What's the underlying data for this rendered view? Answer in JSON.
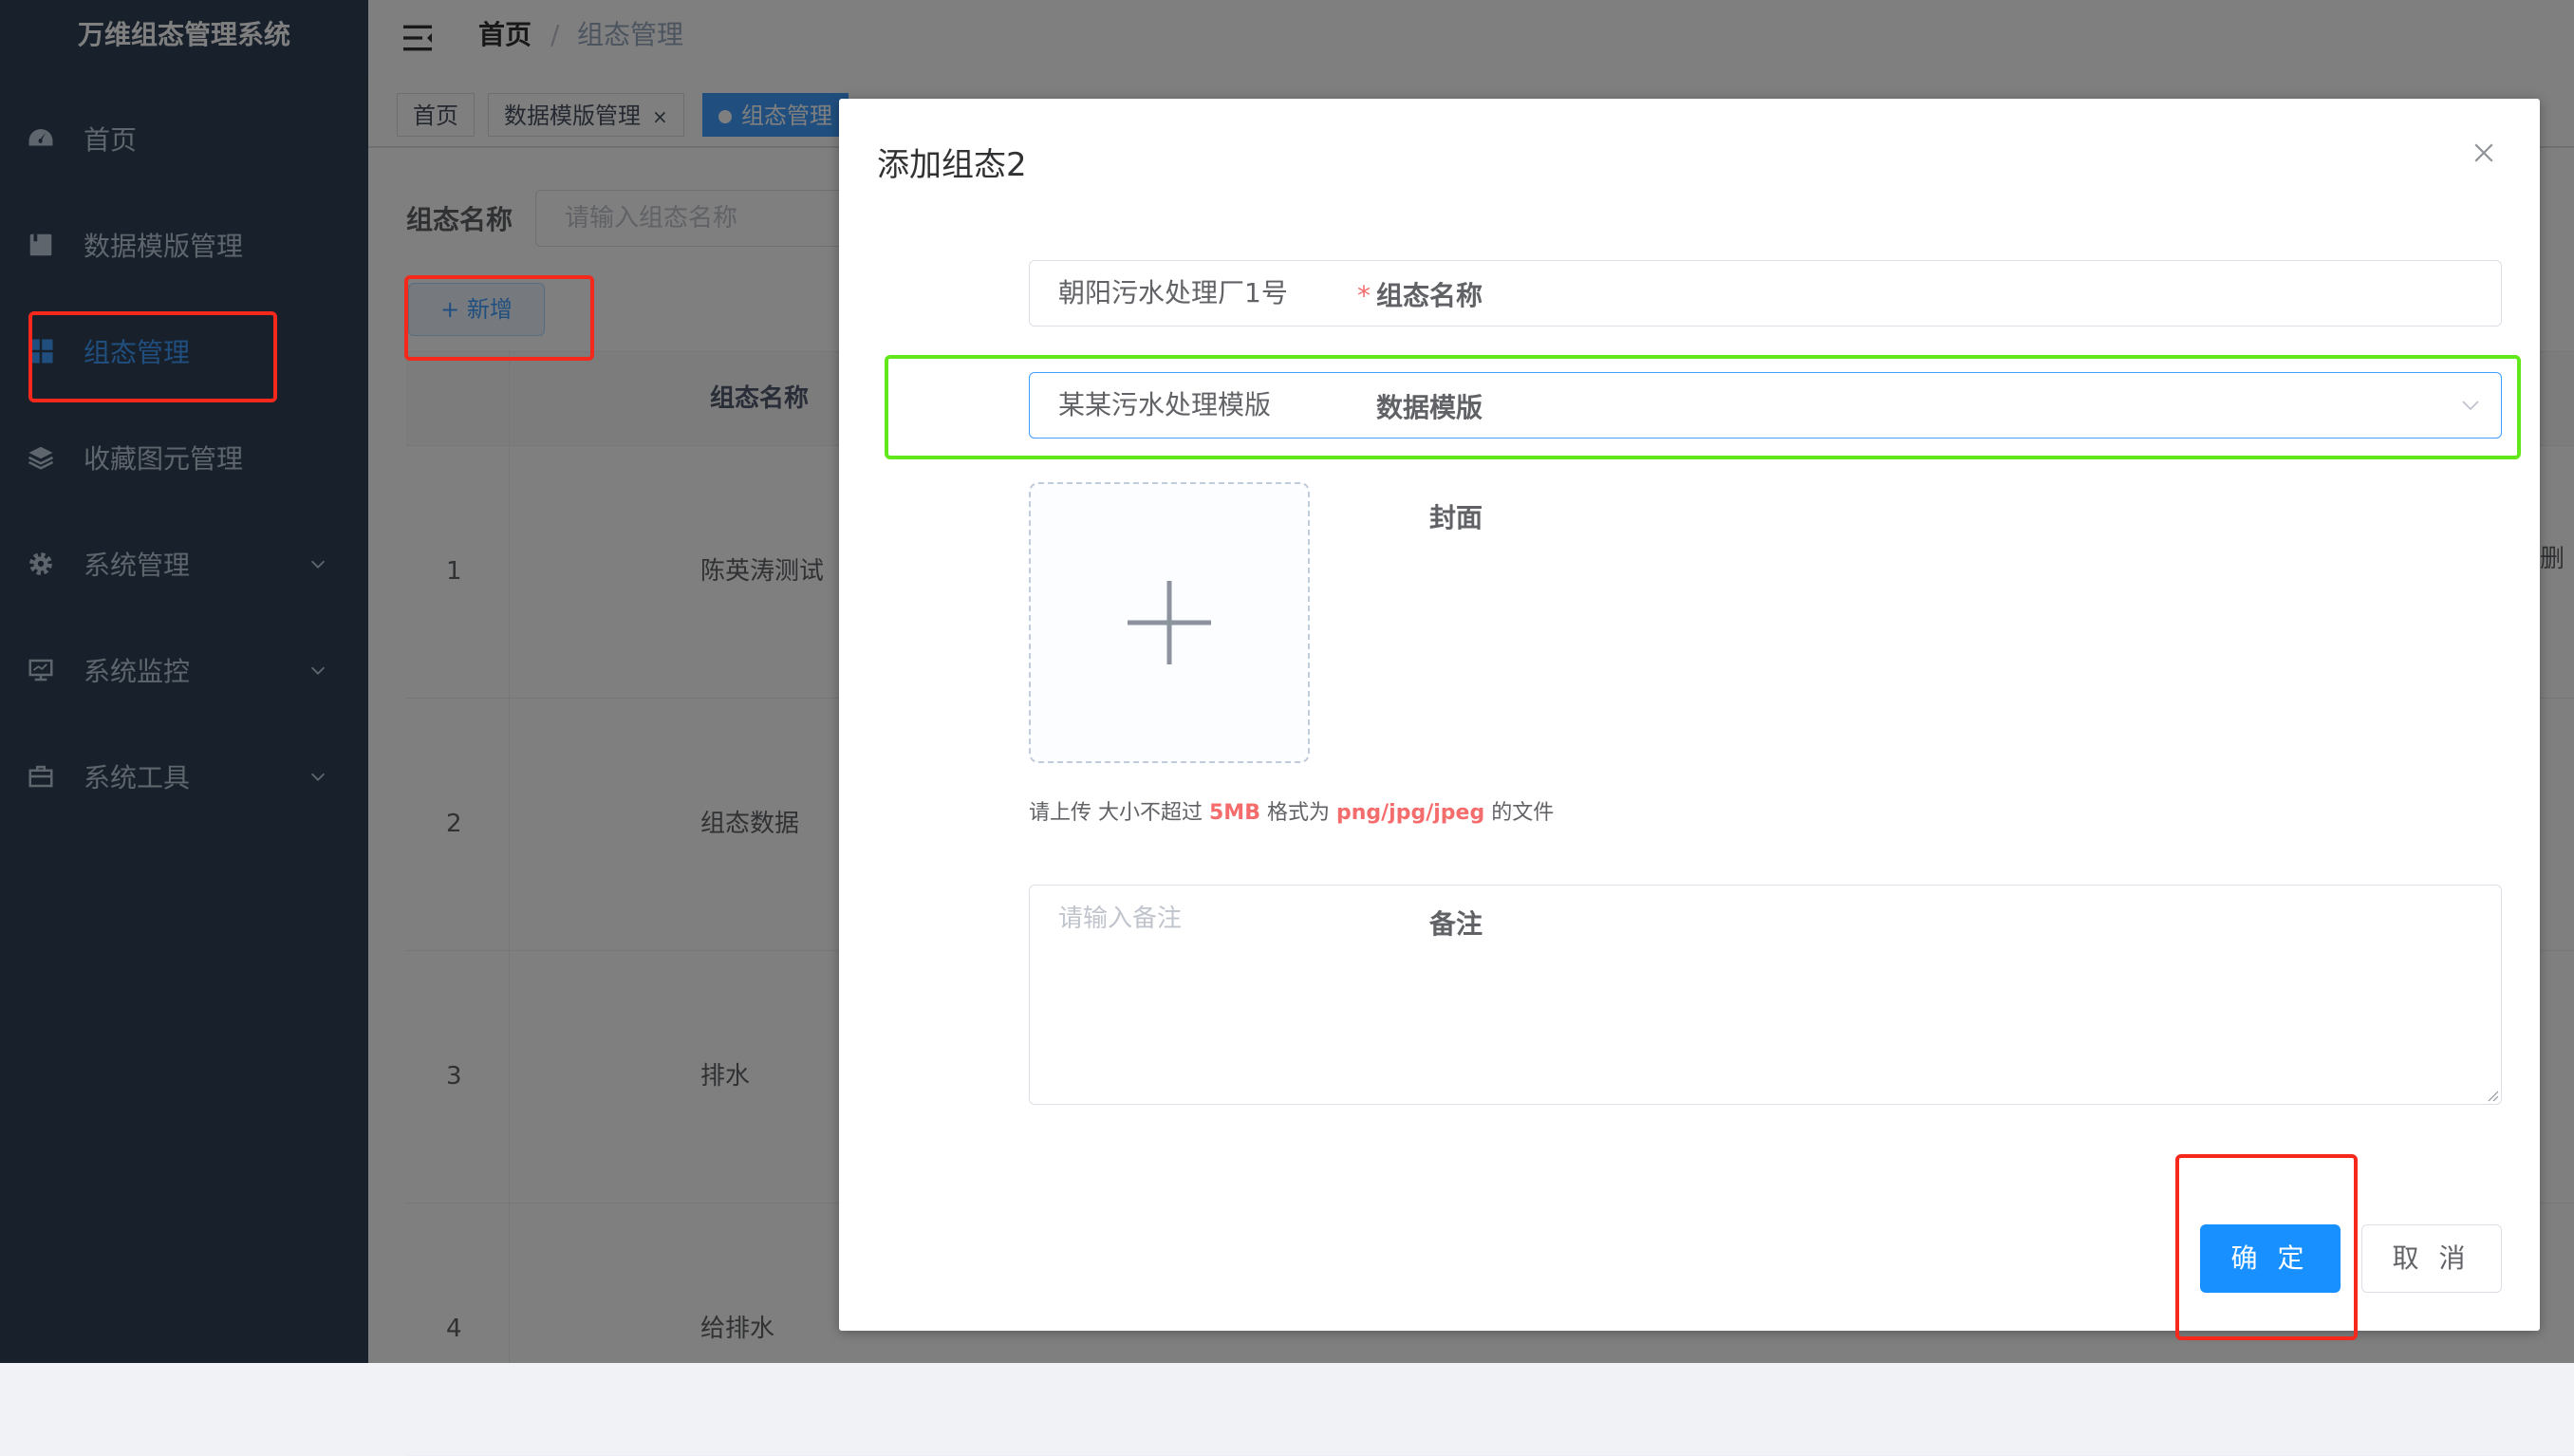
{
  "app": {
    "title": "万维组态管理系统"
  },
  "sidebar": {
    "items": [
      {
        "label": "首页",
        "icon": "dashboard-icon"
      },
      {
        "label": "数据模版管理",
        "icon": "document-icon"
      },
      {
        "label": "组态管理",
        "icon": "grid-icon",
        "active": true
      },
      {
        "label": "收藏图元管理",
        "icon": "layers-icon"
      },
      {
        "label": "系统管理",
        "icon": "gear-icon",
        "expandable": true
      },
      {
        "label": "系统监控",
        "icon": "monitor-icon",
        "expandable": true
      },
      {
        "label": "系统工具",
        "icon": "toolbox-icon",
        "expandable": true
      }
    ]
  },
  "breadcrumb": {
    "home": "首页",
    "separator": "/",
    "current": "组态管理"
  },
  "tags": [
    {
      "label": "首页"
    },
    {
      "label": "数据模版管理",
      "closable": true,
      "close": "×"
    },
    {
      "label": "组态管理",
      "active": true
    }
  ],
  "query": {
    "label": "组态名称",
    "placeholder": "请输入组态名称"
  },
  "toolbar": {
    "add_label": "新增",
    "add_prefix": "+"
  },
  "table": {
    "header_name": "组态名称",
    "rows": [
      {
        "index": "1",
        "name": "陈英涛测试"
      },
      {
        "index": "2",
        "name": "组态数据"
      },
      {
        "index": "3",
        "name": "排水"
      },
      {
        "index": "4",
        "name": "给排水"
      }
    ],
    "side_action": "删"
  },
  "dialog": {
    "title": "添加组态2",
    "close_icon": "close-icon",
    "fields": {
      "name": {
        "label": "组态名称",
        "required_mark": "*",
        "value": "朝阳污水处理厂1号"
      },
      "template": {
        "label": "数据模版",
        "value": "某某污水处理模版"
      },
      "cover": {
        "label": "封面"
      },
      "remark": {
        "label": "备注",
        "placeholder": "请输入备注"
      }
    },
    "upload_tip": {
      "prefix": "请上传 大小不超过 ",
      "size": "5MB",
      "middle": " 格式为 ",
      "formats": "png/jpg/jpeg",
      "suffix": " 的文件"
    },
    "buttons": {
      "confirm": "确 定",
      "cancel": "取 消"
    }
  },
  "colors": {
    "sidebar_bg": "#304156",
    "accent": "#409eff",
    "primary_button": "#1890ff",
    "annotation_red": "#f5281b",
    "annotation_green": "#62e81a"
  }
}
